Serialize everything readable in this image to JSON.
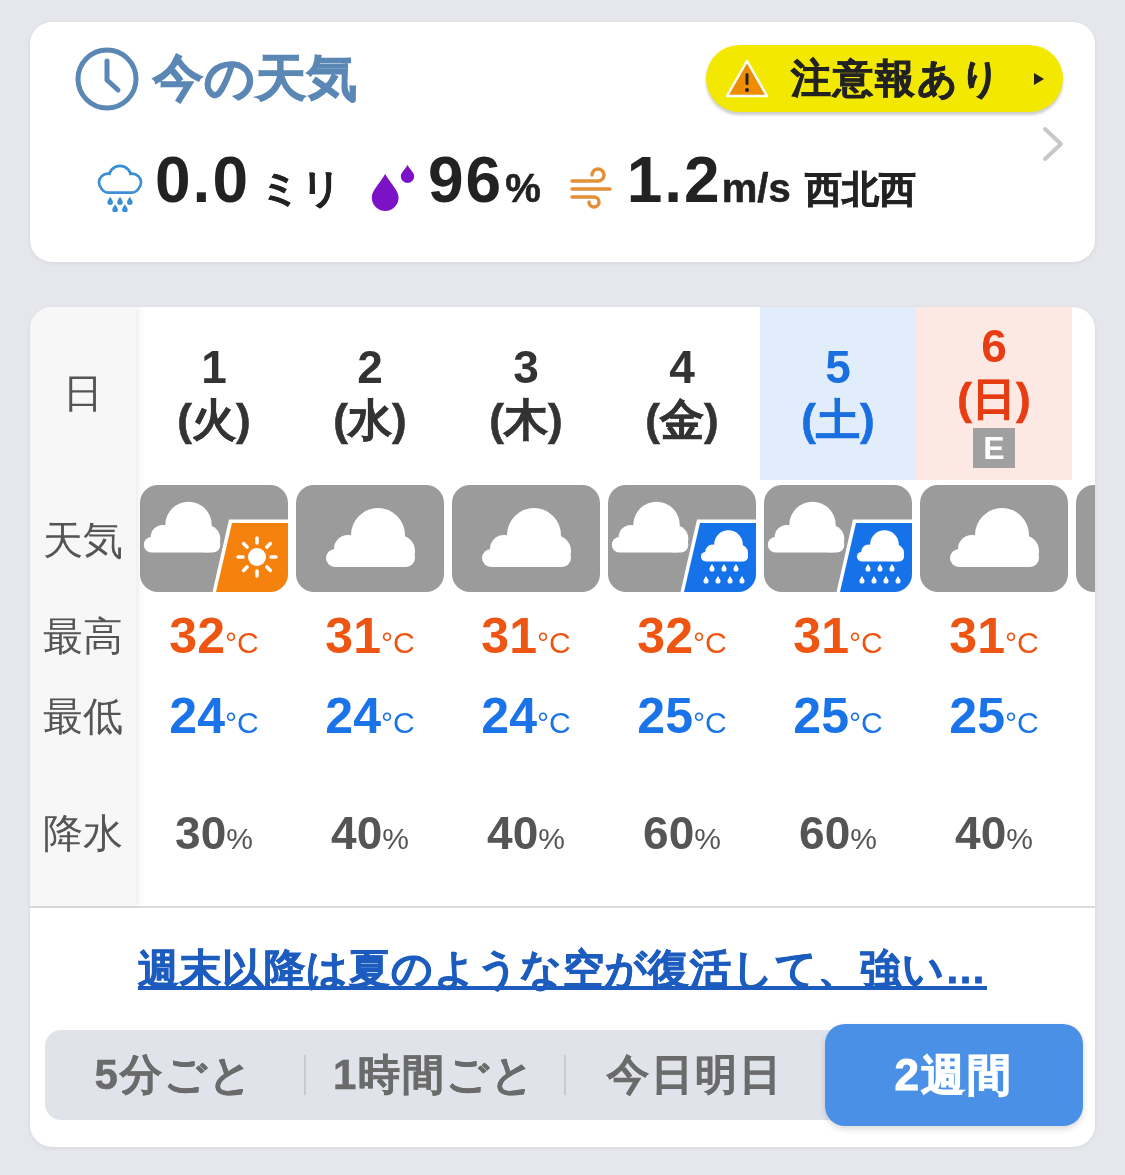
{
  "current": {
    "title": "今の天気",
    "warning": {
      "label": "注意報あり"
    },
    "readings": [
      {
        "kind": "rain",
        "value": "0.0",
        "unit": "ミリ"
      },
      {
        "kind": "humidity",
        "value": "96",
        "unit": "%"
      },
      {
        "kind": "wind",
        "value": "1.2",
        "unit": "m/s",
        "direction": "西北西"
      }
    ]
  },
  "forecast": {
    "row_labels": [
      "日",
      "天気",
      "最高",
      "最低",
      "降水"
    ],
    "days": [
      {
        "kind": "weekday",
        "date": "1",
        "weekday": "(火)",
        "weather": {
          "kind": "cloudy_sunny"
        },
        "high": {
          "value": "32",
          "unit": "°C"
        },
        "low": {
          "value": "24",
          "unit": "°C"
        },
        "precipitation": {
          "value": "30",
          "unit": "%"
        }
      },
      {
        "kind": "weekday",
        "date": "2",
        "weekday": "(水)",
        "weather": {
          "kind": "cloudy"
        },
        "high": {
          "value": "31",
          "unit": "°C"
        },
        "low": {
          "value": "24",
          "unit": "°C"
        },
        "precipitation": {
          "value": "40",
          "unit": "%"
        }
      },
      {
        "kind": "weekday",
        "date": "3",
        "weekday": "(木)",
        "weather": {
          "kind": "cloudy"
        },
        "high": {
          "value": "31",
          "unit": "°C"
        },
        "low": {
          "value": "24",
          "unit": "°C"
        },
        "precipitation": {
          "value": "40",
          "unit": "%"
        }
      },
      {
        "kind": "weekday",
        "date": "4",
        "weekday": "(金)",
        "weather": {
          "kind": "cloudy_rain"
        },
        "high": {
          "value": "32",
          "unit": "°C"
        },
        "low": {
          "value": "25",
          "unit": "°C"
        },
        "precipitation": {
          "value": "60",
          "unit": "%"
        }
      },
      {
        "kind": "saturday",
        "date": "5",
        "weekday": "(土)",
        "weather": {
          "kind": "cloudy_rain"
        },
        "high": {
          "value": "31",
          "unit": "°C"
        },
        "low": {
          "value": "25",
          "unit": "°C"
        },
        "precipitation": {
          "value": "60",
          "unit": "%"
        }
      },
      {
        "kind": "sunday",
        "date": "6",
        "weekday": "(日)",
        "badge": "E",
        "weather": {
          "kind": "cloudy"
        },
        "high": {
          "value": "31",
          "unit": "°C"
        },
        "low": {
          "value": "25",
          "unit": "°C"
        },
        "precipitation": {
          "value": "40",
          "unit": "%"
        }
      }
    ],
    "headline_link": "週末以降は夏のような空が復活して、強い…",
    "tabs": [
      {
        "label": "5分ごと",
        "selected": false
      },
      {
        "label": "1時間ごと",
        "selected": false
      },
      {
        "label": "今日明日",
        "selected": false
      },
      {
        "label": "2週間",
        "selected": true
      }
    ]
  }
}
